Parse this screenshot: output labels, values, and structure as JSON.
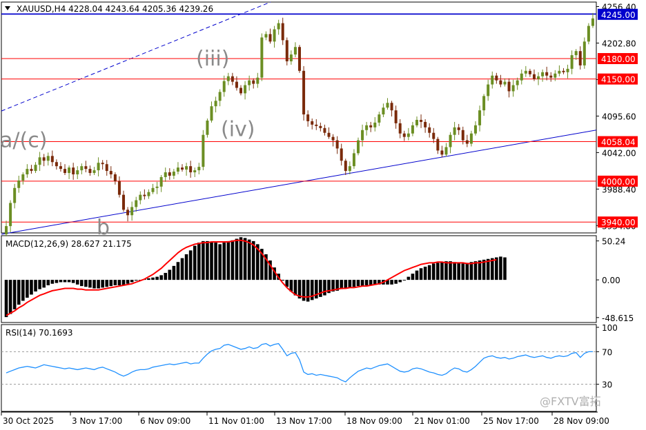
{
  "chart_data": [
    {
      "type": "candlestick",
      "title": "XAUUSD,H4 4228.04 4243.64 4205.36 4239.26",
      "symbol": "XAUUSD,H4",
      "ohlc_last": {
        "open": 4228.04,
        "high": 4243.64,
        "low": 4205.36,
        "close": 4239.26
      },
      "y_tick_labels": [
        "4256.40",
        "4202.80",
        "4149.20",
        "4095.60",
        "4042.00",
        "3988.40",
        "3934.80"
      ],
      "ylim": [
        3924,
        4263
      ],
      "last_price_label": "4245.00",
      "levels": [
        {
          "value": 4180.0,
          "label": "4180.00",
          "color": "#ff0000"
        },
        {
          "value": 4150.0,
          "label": "4150.00",
          "color": "#ff0000"
        },
        {
          "value": 4058.04,
          "label": "4058.04",
          "color": "#ff0000"
        },
        {
          "value": 4000.0,
          "label": "4000.00",
          "color": "#ff0000"
        },
        {
          "value": 3940.0,
          "label": "3940.00",
          "color": "#ff0000"
        }
      ],
      "wave_labels": [
        "a/(c)",
        "b",
        "(iii)",
        "(iv)"
      ],
      "bull_color": "#6b8e23",
      "bear_color": "#7a2a0a",
      "candles_close": [
        3934,
        3968,
        3990,
        4001,
        4010,
        4018,
        4015,
        4024,
        4035,
        4030,
        4037,
        4028,
        4022,
        4018,
        4012,
        4020,
        4010,
        4016,
        4022,
        4018,
        4012,
        4016,
        4027,
        4025,
        4015,
        4010,
        4000,
        3980,
        3958,
        3950,
        3962,
        3972,
        3980,
        3978,
        3984,
        3990,
        3992,
        4006,
        4013,
        4008,
        4014,
        4020,
        4017,
        4022,
        4013,
        4016,
        4021,
        4068,
        4089,
        4110,
        4118,
        4131,
        4147,
        4154,
        4146,
        4137,
        4129,
        4141,
        4148,
        4143,
        4152,
        4211,
        4216,
        4205,
        4223,
        4232,
        4207,
        4176,
        4186,
        4197,
        4162,
        4098,
        4088,
        4083,
        4081,
        4078,
        4071,
        4065,
        4060,
        4048,
        4030,
        4015,
        4022,
        4041,
        4060,
        4075,
        4082,
        4079,
        4086,
        4098,
        4108,
        4115,
        4104,
        4085,
        4070,
        4065,
        4070,
        4082,
        4090,
        4087,
        4079,
        4071,
        4062,
        4045,
        4039,
        4050,
        4068,
        4079,
        4075,
        4060,
        4055,
        4070,
        4082,
        4104,
        4125,
        4142,
        4155,
        4148,
        4142,
        4146,
        4132,
        4141,
        4148,
        4158,
        4162,
        4157,
        4150,
        4154,
        4160,
        4155,
        4152,
        4158,
        4162,
        4160,
        4165,
        4185,
        4191,
        4170,
        4205,
        4228,
        4239
      ]
    },
    {
      "type": "bar",
      "title": "MACD(12,26,9) 28.627 21.175",
      "indicator": "MACD(12,26,9)",
      "macd": 28.627,
      "signal": 21.175,
      "y_tick_labels": [
        "50.24",
        "0.00",
        "-48.615"
      ],
      "ylim": [
        -55,
        57
      ],
      "signal_color": "#ff0000",
      "histogram_color": "#000000",
      "hist_values": [
        -48,
        -44,
        -38,
        -32,
        -27,
        -23,
        -19,
        -15,
        -12,
        -10,
        -7,
        -5,
        -4,
        -3,
        -3,
        -3,
        -4,
        -6,
        -8,
        -9,
        -10,
        -11,
        -11,
        -10,
        -9,
        -8,
        -7,
        -7,
        -7,
        -5,
        -3,
        -1,
        0,
        1,
        2,
        3,
        4,
        6,
        9,
        13,
        18,
        23,
        28,
        33,
        38,
        44,
        48,
        50,
        50,
        49,
        48,
        46,
        48,
        50,
        51,
        53,
        55,
        54,
        52,
        50,
        46,
        40,
        33,
        25,
        16,
        8,
        -1,
        -9,
        -15,
        -20,
        -24,
        -27,
        -28,
        -26,
        -24,
        -22,
        -20,
        -17,
        -15,
        -14,
        -12,
        -11,
        -10,
        -9,
        -8,
        -8,
        -7,
        -7,
        -6,
        -6,
        -6,
        -6,
        -6,
        -5,
        -3,
        0,
        4,
        8,
        12,
        15,
        17,
        19,
        21,
        22,
        23,
        24,
        24,
        23,
        22,
        21,
        22,
        23,
        24,
        25,
        26,
        27,
        28,
        29,
        30,
        29
      ],
      "signal_values": [
        -46,
        -43,
        -40,
        -36,
        -33,
        -29,
        -26,
        -23,
        -20,
        -18,
        -16,
        -14,
        -13,
        -12,
        -11,
        -11,
        -11,
        -12,
        -12,
        -13,
        -13,
        -13,
        -13,
        -12,
        -11,
        -10,
        -9,
        -8,
        -7,
        -6,
        -5,
        -3,
        -1,
        1,
        4,
        7,
        11,
        15,
        20,
        25,
        30,
        35,
        39,
        42,
        44,
        46,
        47,
        48,
        48,
        49,
        49,
        49,
        49,
        49,
        50,
        51,
        51,
        50,
        48,
        45,
        40,
        34,
        27,
        19,
        11,
        3,
        -4,
        -10,
        -15,
        -19,
        -21,
        -22,
        -22,
        -21,
        -19,
        -17,
        -15,
        -14,
        -13,
        -12,
        -11,
        -11,
        -10,
        -10,
        -9,
        -8,
        -8,
        -7,
        -6,
        -5,
        -3,
        0,
        3,
        6,
        9,
        12,
        14,
        16,
        18,
        20,
        21,
        22,
        22,
        23,
        23,
        22,
        22,
        22,
        22,
        22,
        21,
        21,
        22,
        22,
        23,
        24,
        25,
        26
      ]
    },
    {
      "type": "line",
      "title": "RSI(14) 70.1693",
      "indicator": "RSI(14)",
      "value": 70.1693,
      "y_tick_labels": [
        "100",
        "70",
        "30"
      ],
      "ylim": [
        0,
        100
      ],
      "levels": [
        70,
        30
      ],
      "line_color": "#1e90ff",
      "values": [
        44,
        46,
        48,
        50,
        51,
        52,
        51,
        50,
        52,
        54,
        53,
        52,
        51,
        50,
        49,
        50,
        49,
        48,
        49,
        50,
        49,
        48,
        50,
        51,
        49,
        47,
        45,
        42,
        40,
        42,
        45,
        47,
        48,
        48,
        49,
        51,
        52,
        53,
        54,
        55,
        54,
        55,
        56,
        57,
        55,
        56,
        56,
        62,
        67,
        71,
        73,
        74,
        78,
        79,
        77,
        75,
        73,
        74,
        76,
        74,
        75,
        79,
        80,
        77,
        79,
        80,
        73,
        65,
        68,
        69,
        60,
        45,
        42,
        43,
        41,
        42,
        41,
        40,
        39,
        38,
        35,
        33,
        38,
        42,
        46,
        48,
        50,
        49,
        51,
        53,
        54,
        55,
        52,
        49,
        46,
        45,
        46,
        49,
        50,
        49,
        47,
        45,
        44,
        42,
        41,
        43,
        47,
        50,
        49,
        46,
        45,
        48,
        52,
        57,
        62,
        64,
        65,
        63,
        62,
        63,
        61,
        62,
        64,
        65,
        66,
        64,
        63,
        64,
        65,
        63,
        62,
        64,
        65,
        64,
        65,
        68,
        69,
        63,
        68,
        70,
        70
      ]
    },
    {
      "x_tick_labels": [
        "30 Oct 2025",
        "3 Nov 17:00",
        "6 Nov 09:00",
        "11 Nov 01:00",
        "13 Nov 17:00",
        "18 Nov 09:00",
        "21 Nov 01:00",
        "25 Nov 17:00",
        "28 Nov 09:00"
      ],
      "watermark": "@FXTV富拓"
    }
  ]
}
